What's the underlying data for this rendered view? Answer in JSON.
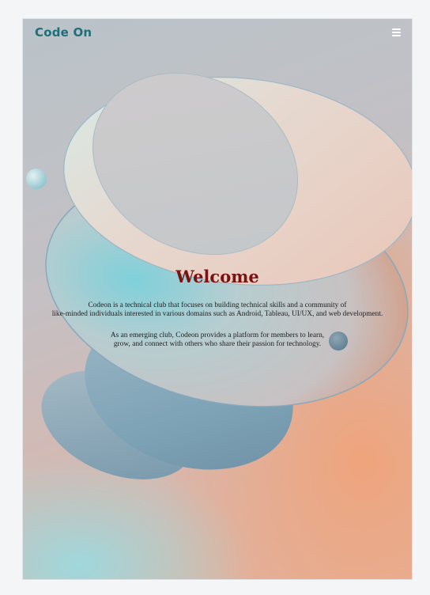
{
  "nav": {
    "logo": "Code On",
    "menu_icon": "hamburger-menu-icon"
  },
  "hero": {
    "title": "Welcome",
    "paragraph_1_line_1": "Codeon is a technical club that focuses on building technical skills and a community of",
    "paragraph_1_line_2": "like-minded individuals interested in various domains such as Android, Tableau, UI/UX, and web development.",
    "paragraph_2_line_1": "As an emerging club, Codeon provides a platform for members to learn,",
    "paragraph_2_line_2": "grow, and connect with others who share their passion for technology."
  },
  "colors": {
    "logo": "#1f6f78",
    "title": "#7a1212",
    "menu_icon": "#ffffff",
    "accent_orange": "#efa47c",
    "accent_teal": "#9fd8dc"
  }
}
